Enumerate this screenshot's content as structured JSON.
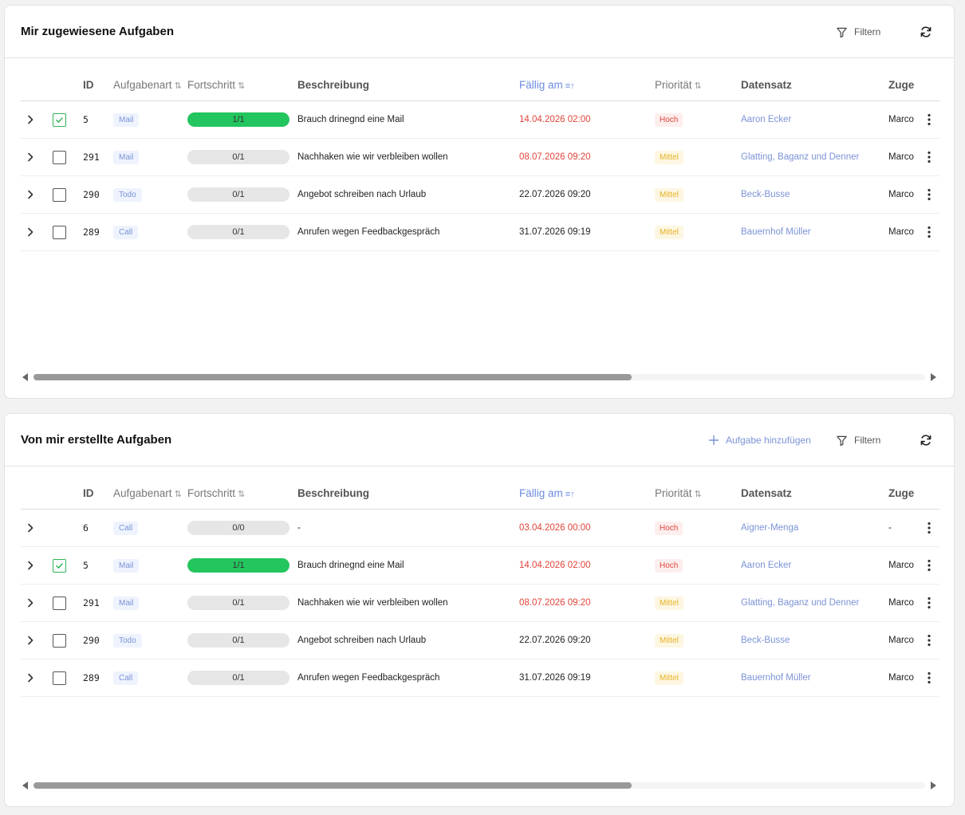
{
  "columns": {
    "id": "ID",
    "type": "Aufgabenart",
    "progress": "Fortschritt",
    "description": "Beschreibung",
    "due": "Fällig am",
    "priority": "Priorität",
    "dataset": "Datensatz",
    "assignee": "Zuge"
  },
  "assigned": {
    "title": "Mir zugewiesene Aufgaben",
    "filter_label": "Filtern",
    "rows": [
      {
        "checked": true,
        "id": "5",
        "type": "Mail",
        "progress": "1/1",
        "progress_fraction": 1,
        "description": "Brauch drinegnd eine Mail",
        "due": "14.04.2026 02:00",
        "due_overdue": true,
        "priority": "Hoch",
        "priority_level": "high",
        "dataset": "Aaron Ecker",
        "assignee": "Marco"
      },
      {
        "checked": false,
        "id": "291",
        "type": "Mail",
        "progress": "0/1",
        "progress_fraction": 0,
        "description": "Nachhaken wie wir verbleiben wollen",
        "due": "08.07.2026 09:20",
        "due_overdue": true,
        "priority": "Mittel",
        "priority_level": "mid",
        "dataset": "Glatting, Baganz und Denner",
        "assignee": "Marco"
      },
      {
        "checked": false,
        "id": "290",
        "type": "Todo",
        "progress": "0/1",
        "progress_fraction": 0,
        "description": "Angebot schreiben nach Urlaub",
        "due": "22.07.2026 09:20",
        "due_overdue": false,
        "priority": "Mittel",
        "priority_level": "mid",
        "dataset": "Beck-Busse",
        "assignee": "Marco"
      },
      {
        "checked": false,
        "id": "289",
        "type": "Call",
        "progress": "0/1",
        "progress_fraction": 0,
        "description": "Anrufen wegen Feedbackgespräch",
        "due": "31.07.2026 09:19",
        "due_overdue": false,
        "priority": "Mittel",
        "priority_level": "mid",
        "dataset": "Bauernhof Müller",
        "assignee": "Marco"
      }
    ]
  },
  "created": {
    "title": "Von mir erstellte Aufgaben",
    "add_label": "Aufgabe hinzufügen",
    "filter_label": "Filtern",
    "rows": [
      {
        "checked": null,
        "id": "6",
        "type": "Call",
        "progress": "0/0",
        "progress_fraction": 0,
        "description": "-",
        "due": "03.04.2026 00:00",
        "due_overdue": true,
        "priority": "Hoch",
        "priority_level": "high",
        "dataset": "Aigner-Menga",
        "assignee": "-"
      },
      {
        "checked": true,
        "id": "5",
        "type": "Mail",
        "progress": "1/1",
        "progress_fraction": 1,
        "description": "Brauch drinegnd eine Mail",
        "due": "14.04.2026 02:00",
        "due_overdue": true,
        "priority": "Hoch",
        "priority_level": "high",
        "dataset": "Aaron Ecker",
        "assignee": "Marco"
      },
      {
        "checked": false,
        "id": "291",
        "type": "Mail",
        "progress": "0/1",
        "progress_fraction": 0,
        "description": "Nachhaken wie wir verbleiben wollen",
        "due": "08.07.2026 09:20",
        "due_overdue": true,
        "priority": "Mittel",
        "priority_level": "mid",
        "dataset": "Glatting, Baganz und Denner",
        "assignee": "Marco"
      },
      {
        "checked": false,
        "id": "290",
        "type": "Todo",
        "progress": "0/1",
        "progress_fraction": 0,
        "description": "Angebot schreiben nach Urlaub",
        "due": "22.07.2026 09:20",
        "due_overdue": false,
        "priority": "Mittel",
        "priority_level": "mid",
        "dataset": "Beck-Busse",
        "assignee": "Marco"
      },
      {
        "checked": false,
        "id": "289",
        "type": "Call",
        "progress": "0/1",
        "progress_fraction": 0,
        "description": "Anrufen wegen Feedbackgespräch",
        "due": "31.07.2026 09:19",
        "due_overdue": false,
        "priority": "Mittel",
        "priority_level": "mid",
        "dataset": "Bauernhof Müller",
        "assignee": "Marco"
      }
    ]
  },
  "icons": {
    "filter": "filter-icon",
    "refresh": "refresh-icon",
    "add": "plus-icon",
    "expand": "chevron-right-icon",
    "more": "more-vertical-icon",
    "sort": "sort-icon"
  },
  "colors": {
    "accent": "#6d8ce0",
    "overdue": "#e0453a",
    "progress_done": "#22c55e",
    "priority_high_bg": "#fdeeee",
    "priority_mid_bg": "#fdf6e2"
  }
}
